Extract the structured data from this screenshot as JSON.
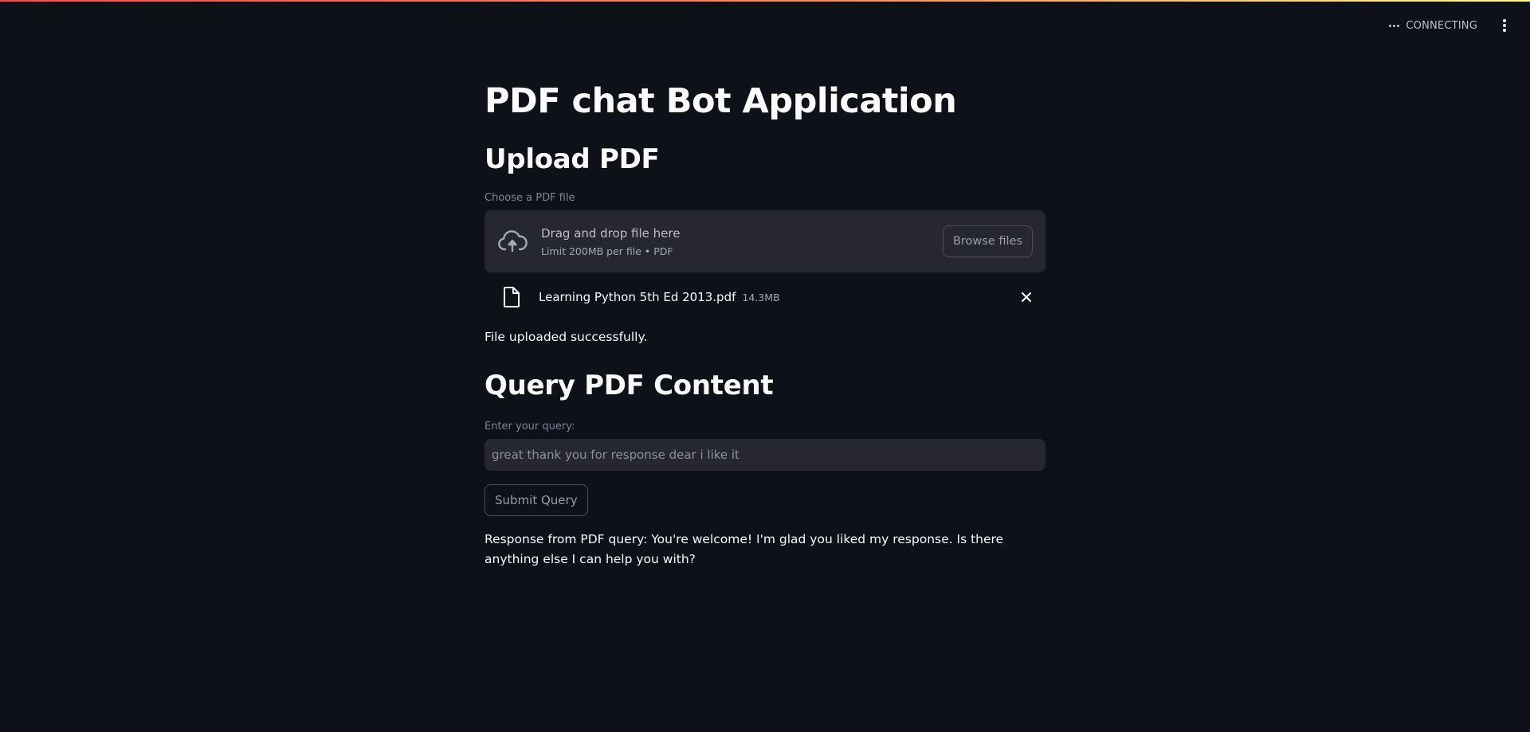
{
  "toolbar": {
    "status_text": "CONNECTING"
  },
  "main": {
    "title": "PDF chat Bot Application",
    "upload_heading": "Upload PDF",
    "uploader": {
      "label": "Choose a PDF file",
      "drop_title": "Drag and drop file here",
      "drop_subtitle": "Limit 200MB per file • PDF",
      "browse_label": "Browse files"
    },
    "file": {
      "name": "Learning Python 5th Ed 2013.pdf",
      "size": "14.3MB"
    },
    "success_message": "File uploaded successfully.",
    "query_heading": "Query PDF Content",
    "query": {
      "label": "Enter your query:",
      "value": "great thank you for response dear i like it",
      "submit_label": "Submit Query"
    },
    "response_text": "Response from PDF query: You're welcome! I'm glad you liked my response. Is there anything else I can help you with?"
  },
  "colors": {
    "background": "#0e1117",
    "surface": "#262730",
    "text": "#fafafa",
    "muted": "#808495",
    "accent_gradient_start": "#ff4b4b",
    "accent_gradient_end": "#fffd80"
  },
  "icons": [
    "cloud-upload-icon",
    "file-icon",
    "close-icon",
    "more-horizontal-icon",
    "more-vertical-icon"
  ]
}
